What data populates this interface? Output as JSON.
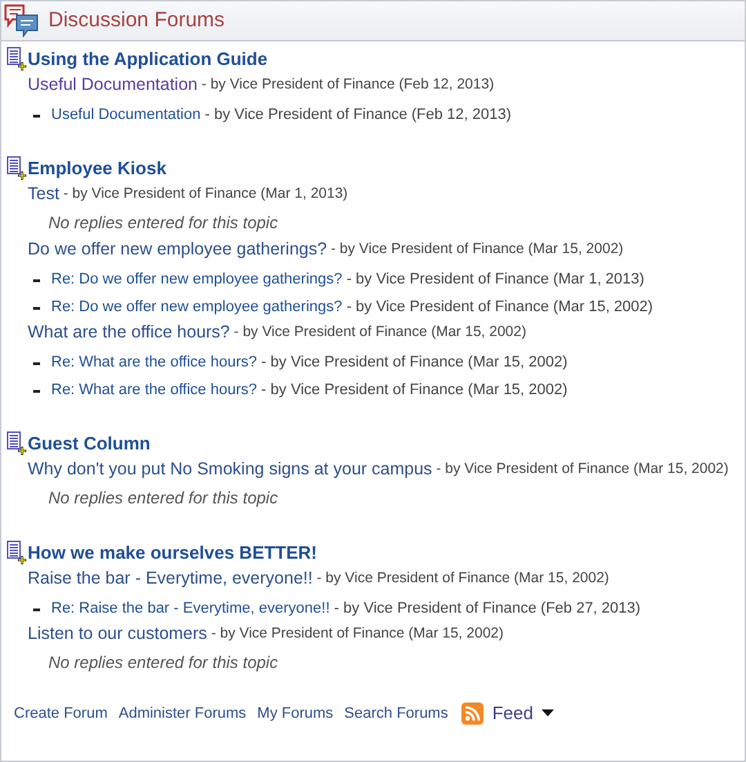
{
  "header": {
    "title": "Discussion Forums"
  },
  "forums": [
    {
      "title": "Using the Application Guide",
      "topics": [
        {
          "title": "Useful Documentation",
          "visited": true,
          "meta": " - by Vice President of Finance (Feb 12, 2013)",
          "replies": [
            {
              "title": "Useful Documentation",
              "meta": " - by Vice President of Finance (Feb 12, 2013)"
            }
          ]
        }
      ]
    },
    {
      "title": "Employee Kiosk",
      "topics": [
        {
          "title": "Test",
          "visited": false,
          "meta": " - by Vice President of Finance (Mar 1, 2013)",
          "no_replies": "No replies entered for this topic"
        },
        {
          "title": "Do we offer new employee gatherings?",
          "visited": false,
          "meta": " - by Vice President of Finance (Mar 15, 2002)",
          "replies": [
            {
              "title": "Re: Do we offer new employee gatherings?",
              "meta": " - by Vice President of Finance (Mar 1, 2013)"
            },
            {
              "title": "Re: Do we offer new employee gatherings?",
              "meta": " - by Vice President of Finance (Mar 15, 2002)"
            }
          ]
        },
        {
          "title": "What are the office hours?",
          "visited": false,
          "meta": " - by Vice President of Finance (Mar 15, 2002)",
          "replies": [
            {
              "title": "Re: What are the office hours?",
              "meta": " - by Vice President of Finance (Mar 15, 2002)"
            },
            {
              "title": "Re: What are the office hours?",
              "meta": " - by Vice President of Finance (Mar 15, 2002)"
            }
          ]
        }
      ]
    },
    {
      "title": "Guest Column",
      "topics": [
        {
          "title": "Why don't you put No Smoking signs at your campus",
          "visited": false,
          "meta": " - by Vice President of Finance (Mar 15, 2002)",
          "no_replies": "No replies entered for this topic"
        }
      ]
    },
    {
      "title": "How we make ourselves BETTER!",
      "topics": [
        {
          "title": "Raise the bar - Everytime, everyone!!",
          "visited": false,
          "meta": " - by Vice President of Finance (Mar 15, 2002)",
          "replies": [
            {
              "title": "Re: Raise the bar - Everytime, everyone!!",
              "meta": " - by Vice President of Finance (Feb 27, 2013)"
            }
          ]
        },
        {
          "title": "Listen to our customers",
          "visited": false,
          "meta": " - by Vice President of Finance (Mar 15, 2002)",
          "no_replies": "No replies entered for this topic"
        }
      ]
    }
  ],
  "footer_links": [
    "Create Forum",
    "Administer Forums",
    "My Forums",
    "Search Forums"
  ],
  "feed": {
    "label": "Feed"
  }
}
